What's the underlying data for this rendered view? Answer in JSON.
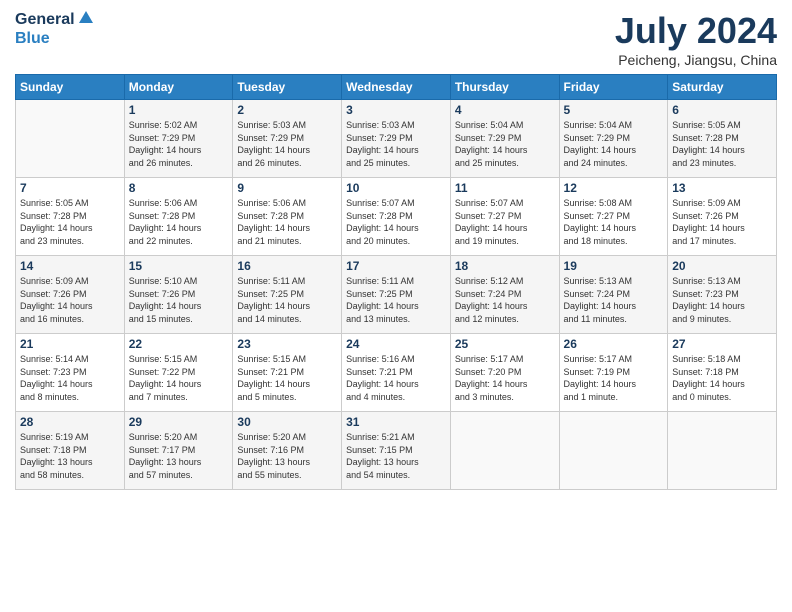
{
  "header": {
    "logo_general": "General",
    "logo_blue": "Blue",
    "month_year": "July 2024",
    "location": "Peicheng, Jiangsu, China"
  },
  "days_of_week": [
    "Sunday",
    "Monday",
    "Tuesday",
    "Wednesday",
    "Thursday",
    "Friday",
    "Saturday"
  ],
  "weeks": [
    [
      {
        "day": "",
        "info": ""
      },
      {
        "day": "1",
        "info": "Sunrise: 5:02 AM\nSunset: 7:29 PM\nDaylight: 14 hours\nand 26 minutes."
      },
      {
        "day": "2",
        "info": "Sunrise: 5:03 AM\nSunset: 7:29 PM\nDaylight: 14 hours\nand 26 minutes."
      },
      {
        "day": "3",
        "info": "Sunrise: 5:03 AM\nSunset: 7:29 PM\nDaylight: 14 hours\nand 25 minutes."
      },
      {
        "day": "4",
        "info": "Sunrise: 5:04 AM\nSunset: 7:29 PM\nDaylight: 14 hours\nand 25 minutes."
      },
      {
        "day": "5",
        "info": "Sunrise: 5:04 AM\nSunset: 7:29 PM\nDaylight: 14 hours\nand 24 minutes."
      },
      {
        "day": "6",
        "info": "Sunrise: 5:05 AM\nSunset: 7:28 PM\nDaylight: 14 hours\nand 23 minutes."
      }
    ],
    [
      {
        "day": "7",
        "info": "Sunrise: 5:05 AM\nSunset: 7:28 PM\nDaylight: 14 hours\nand 23 minutes."
      },
      {
        "day": "8",
        "info": "Sunrise: 5:06 AM\nSunset: 7:28 PM\nDaylight: 14 hours\nand 22 minutes."
      },
      {
        "day": "9",
        "info": "Sunrise: 5:06 AM\nSunset: 7:28 PM\nDaylight: 14 hours\nand 21 minutes."
      },
      {
        "day": "10",
        "info": "Sunrise: 5:07 AM\nSunset: 7:28 PM\nDaylight: 14 hours\nand 20 minutes."
      },
      {
        "day": "11",
        "info": "Sunrise: 5:07 AM\nSunset: 7:27 PM\nDaylight: 14 hours\nand 19 minutes."
      },
      {
        "day": "12",
        "info": "Sunrise: 5:08 AM\nSunset: 7:27 PM\nDaylight: 14 hours\nand 18 minutes."
      },
      {
        "day": "13",
        "info": "Sunrise: 5:09 AM\nSunset: 7:26 PM\nDaylight: 14 hours\nand 17 minutes."
      }
    ],
    [
      {
        "day": "14",
        "info": "Sunrise: 5:09 AM\nSunset: 7:26 PM\nDaylight: 14 hours\nand 16 minutes."
      },
      {
        "day": "15",
        "info": "Sunrise: 5:10 AM\nSunset: 7:26 PM\nDaylight: 14 hours\nand 15 minutes."
      },
      {
        "day": "16",
        "info": "Sunrise: 5:11 AM\nSunset: 7:25 PM\nDaylight: 14 hours\nand 14 minutes."
      },
      {
        "day": "17",
        "info": "Sunrise: 5:11 AM\nSunset: 7:25 PM\nDaylight: 14 hours\nand 13 minutes."
      },
      {
        "day": "18",
        "info": "Sunrise: 5:12 AM\nSunset: 7:24 PM\nDaylight: 14 hours\nand 12 minutes."
      },
      {
        "day": "19",
        "info": "Sunrise: 5:13 AM\nSunset: 7:24 PM\nDaylight: 14 hours\nand 11 minutes."
      },
      {
        "day": "20",
        "info": "Sunrise: 5:13 AM\nSunset: 7:23 PM\nDaylight: 14 hours\nand 9 minutes."
      }
    ],
    [
      {
        "day": "21",
        "info": "Sunrise: 5:14 AM\nSunset: 7:23 PM\nDaylight: 14 hours\nand 8 minutes."
      },
      {
        "day": "22",
        "info": "Sunrise: 5:15 AM\nSunset: 7:22 PM\nDaylight: 14 hours\nand 7 minutes."
      },
      {
        "day": "23",
        "info": "Sunrise: 5:15 AM\nSunset: 7:21 PM\nDaylight: 14 hours\nand 5 minutes."
      },
      {
        "day": "24",
        "info": "Sunrise: 5:16 AM\nSunset: 7:21 PM\nDaylight: 14 hours\nand 4 minutes."
      },
      {
        "day": "25",
        "info": "Sunrise: 5:17 AM\nSunset: 7:20 PM\nDaylight: 14 hours\nand 3 minutes."
      },
      {
        "day": "26",
        "info": "Sunrise: 5:17 AM\nSunset: 7:19 PM\nDaylight: 14 hours\nand 1 minute."
      },
      {
        "day": "27",
        "info": "Sunrise: 5:18 AM\nSunset: 7:18 PM\nDaylight: 14 hours\nand 0 minutes."
      }
    ],
    [
      {
        "day": "28",
        "info": "Sunrise: 5:19 AM\nSunset: 7:18 PM\nDaylight: 13 hours\nand 58 minutes."
      },
      {
        "day": "29",
        "info": "Sunrise: 5:20 AM\nSunset: 7:17 PM\nDaylight: 13 hours\nand 57 minutes."
      },
      {
        "day": "30",
        "info": "Sunrise: 5:20 AM\nSunset: 7:16 PM\nDaylight: 13 hours\nand 55 minutes."
      },
      {
        "day": "31",
        "info": "Sunrise: 5:21 AM\nSunset: 7:15 PM\nDaylight: 13 hours\nand 54 minutes."
      },
      {
        "day": "",
        "info": ""
      },
      {
        "day": "",
        "info": ""
      },
      {
        "day": "",
        "info": ""
      }
    ]
  ]
}
